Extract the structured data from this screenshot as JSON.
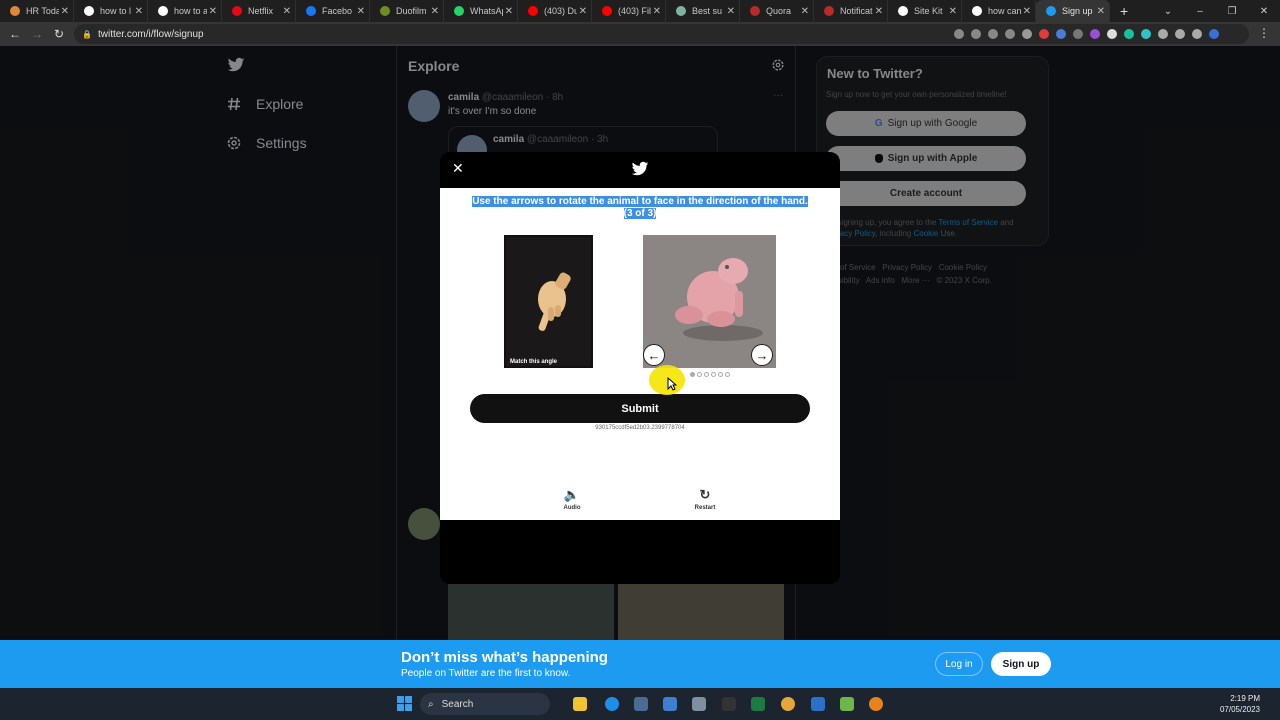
{
  "browser": {
    "tabs": [
      {
        "label": "HR Toda",
        "color": "#e0873a"
      },
      {
        "label": "how to l",
        "color": "#ffffff"
      },
      {
        "label": "how to a",
        "color": "#ffffff"
      },
      {
        "label": "Netflix",
        "color": "#e50914"
      },
      {
        "label": "Facebo",
        "color": "#1877f2"
      },
      {
        "label": "Duofilm",
        "color": "#6b8e23"
      },
      {
        "label": "WhatsAp",
        "color": "#25d366"
      },
      {
        "label": "(403) Du",
        "color": "#ff0000"
      },
      {
        "label": "(403) Fil",
        "color": "#ff0000"
      },
      {
        "label": "Best su",
        "color": "#7fb3a0"
      },
      {
        "label": "Quora",
        "color": "#b92b27"
      },
      {
        "label": "Notificat",
        "color": "#b92b27"
      },
      {
        "label": "Site Kit",
        "color": "#ffffff"
      },
      {
        "label": "how can",
        "color": "#ffffff"
      },
      {
        "label": "Sign up",
        "color": "#1d9bf0"
      }
    ],
    "active_tab": 14,
    "new_tab": "+",
    "url": "twitter.com/i/flow/signup"
  },
  "sidebar": {
    "items": [
      {
        "label": "Explore",
        "icon": "hashtag-icon"
      },
      {
        "label": "Settings",
        "icon": "gear-icon"
      }
    ]
  },
  "feed": {
    "title": "Explore",
    "tweet": {
      "name": "camila",
      "handle": "@caaamileon · 8h",
      "text": "it's over I'm so done"
    },
    "quote": {
      "name": "camila",
      "handle": "@caaamileon · 3h"
    }
  },
  "signup_panel": {
    "title": "New to Twitter?",
    "subtitle": "Sign up now to get your own personalized timeline!",
    "google_btn": "Sign up with Google",
    "apple_btn": "Sign up with Apple",
    "create_btn": "Create account",
    "legal_prefix": "By signing up, you agree to the",
    "terms": "Terms of Service",
    "and": "and",
    "privacy": "Privacy Policy",
    "including": ", including",
    "cookie": "Cookie Use."
  },
  "footer_links": {
    "line1": "Terms of Service   Privacy Policy   Cookie Policy",
    "line2": "Accessibility   Ads info   More ···   © 2023 X Corp."
  },
  "banner": {
    "title": "Don’t miss what’s happening",
    "subtitle": "People on Twitter are the first to know.",
    "login": "Log in",
    "signup": "Sign up"
  },
  "captcha": {
    "instruction": "Use the arrows to rotate the animal to face in the direction of the hand.",
    "progress": "(3 of 3)",
    "match_caption": "Match this angle",
    "submit": "Submit",
    "session_id": "930175ccdf5ed2b03.2399778704",
    "audio": "Audio",
    "restart": "Restart",
    "position_count": 6,
    "position_selected": 1
  },
  "taskbar": {
    "search": "Search",
    "time": "2:19 PM",
    "date": "07/05/2023"
  }
}
